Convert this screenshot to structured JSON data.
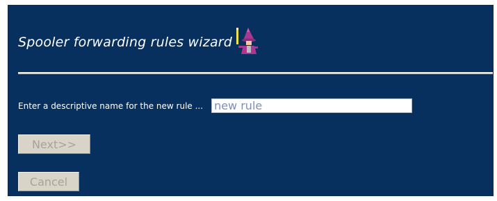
{
  "wizard": {
    "title": "Spooler forwarding rules wizard",
    "icon": "wizard-icon"
  },
  "form": {
    "prompt_label": "Enter a descriptive name for the new rule ...",
    "rule_name_value": "new rule"
  },
  "buttons": {
    "next_label": "Next>>",
    "cancel_label": "Cancel"
  },
  "colors": {
    "panel_background": "#08305f",
    "button_face": "#d8d4c7",
    "disabled_text": "#a8a39a"
  }
}
